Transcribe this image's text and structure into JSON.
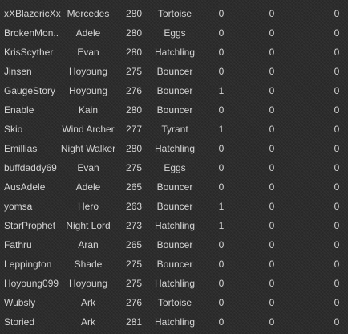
{
  "rows": [
    {
      "name": "xXBlazericXx",
      "class": "Mercedes",
      "level": "280",
      "pet": "Tortoise",
      "v1": "0",
      "v2": "0",
      "v3": "0"
    },
    {
      "name": "BrokenMon..",
      "class": "Adele",
      "level": "280",
      "pet": "Eggs",
      "v1": "0",
      "v2": "0",
      "v3": "0"
    },
    {
      "name": "KrisScyther",
      "class": "Evan",
      "level": "280",
      "pet": "Hatchling",
      "v1": "0",
      "v2": "0",
      "v3": "0"
    },
    {
      "name": "Jinsen",
      "class": "Hoyoung",
      "level": "275",
      "pet": "Bouncer",
      "v1": "0",
      "v2": "0",
      "v3": "0"
    },
    {
      "name": "GaugeStory",
      "class": "Hoyoung",
      "level": "276",
      "pet": "Bouncer",
      "v1": "1",
      "v2": "0",
      "v3": "0"
    },
    {
      "name": "Enable",
      "class": "Kain",
      "level": "280",
      "pet": "Bouncer",
      "v1": "0",
      "v2": "0",
      "v3": "0"
    },
    {
      "name": "Skio",
      "class": "Wind Archer",
      "level": "277",
      "pet": "Tyrant",
      "v1": "1",
      "v2": "0",
      "v3": "0"
    },
    {
      "name": "Emillias",
      "class": "Night Walker",
      "level": "280",
      "pet": "Hatchling",
      "v1": "0",
      "v2": "0",
      "v3": "0"
    },
    {
      "name": "buffdaddy69",
      "class": "Evan",
      "level": "275",
      "pet": "Eggs",
      "v1": "0",
      "v2": "0",
      "v3": "0"
    },
    {
      "name": "AusAdele",
      "class": "Adele",
      "level": "265",
      "pet": "Bouncer",
      "v1": "0",
      "v2": "0",
      "v3": "0"
    },
    {
      "name": "yomsa",
      "class": "Hero",
      "level": "263",
      "pet": "Bouncer",
      "v1": "1",
      "v2": "0",
      "v3": "0"
    },
    {
      "name": "StarProphet",
      "class": "Night Lord",
      "level": "273",
      "pet": "Hatchling",
      "v1": "1",
      "v2": "0",
      "v3": "0"
    },
    {
      "name": "Fathru",
      "class": "Aran",
      "level": "265",
      "pet": "Bouncer",
      "v1": "0",
      "v2": "0",
      "v3": "0"
    },
    {
      "name": "Leppington",
      "class": "Shade",
      "level": "275",
      "pet": "Bouncer",
      "v1": "0",
      "v2": "0",
      "v3": "0"
    },
    {
      "name": "Hoyoung099",
      "class": "Hoyoung",
      "level": "275",
      "pet": "Hatchling",
      "v1": "0",
      "v2": "0",
      "v3": "0"
    },
    {
      "name": "Wubsly",
      "class": "Ark",
      "level": "276",
      "pet": "Tortoise",
      "v1": "0",
      "v2": "0",
      "v3": "0"
    },
    {
      "name": "Storied",
      "class": "Ark",
      "level": "281",
      "pet": "Hatchling",
      "v1": "0",
      "v2": "0",
      "v3": "0"
    }
  ]
}
